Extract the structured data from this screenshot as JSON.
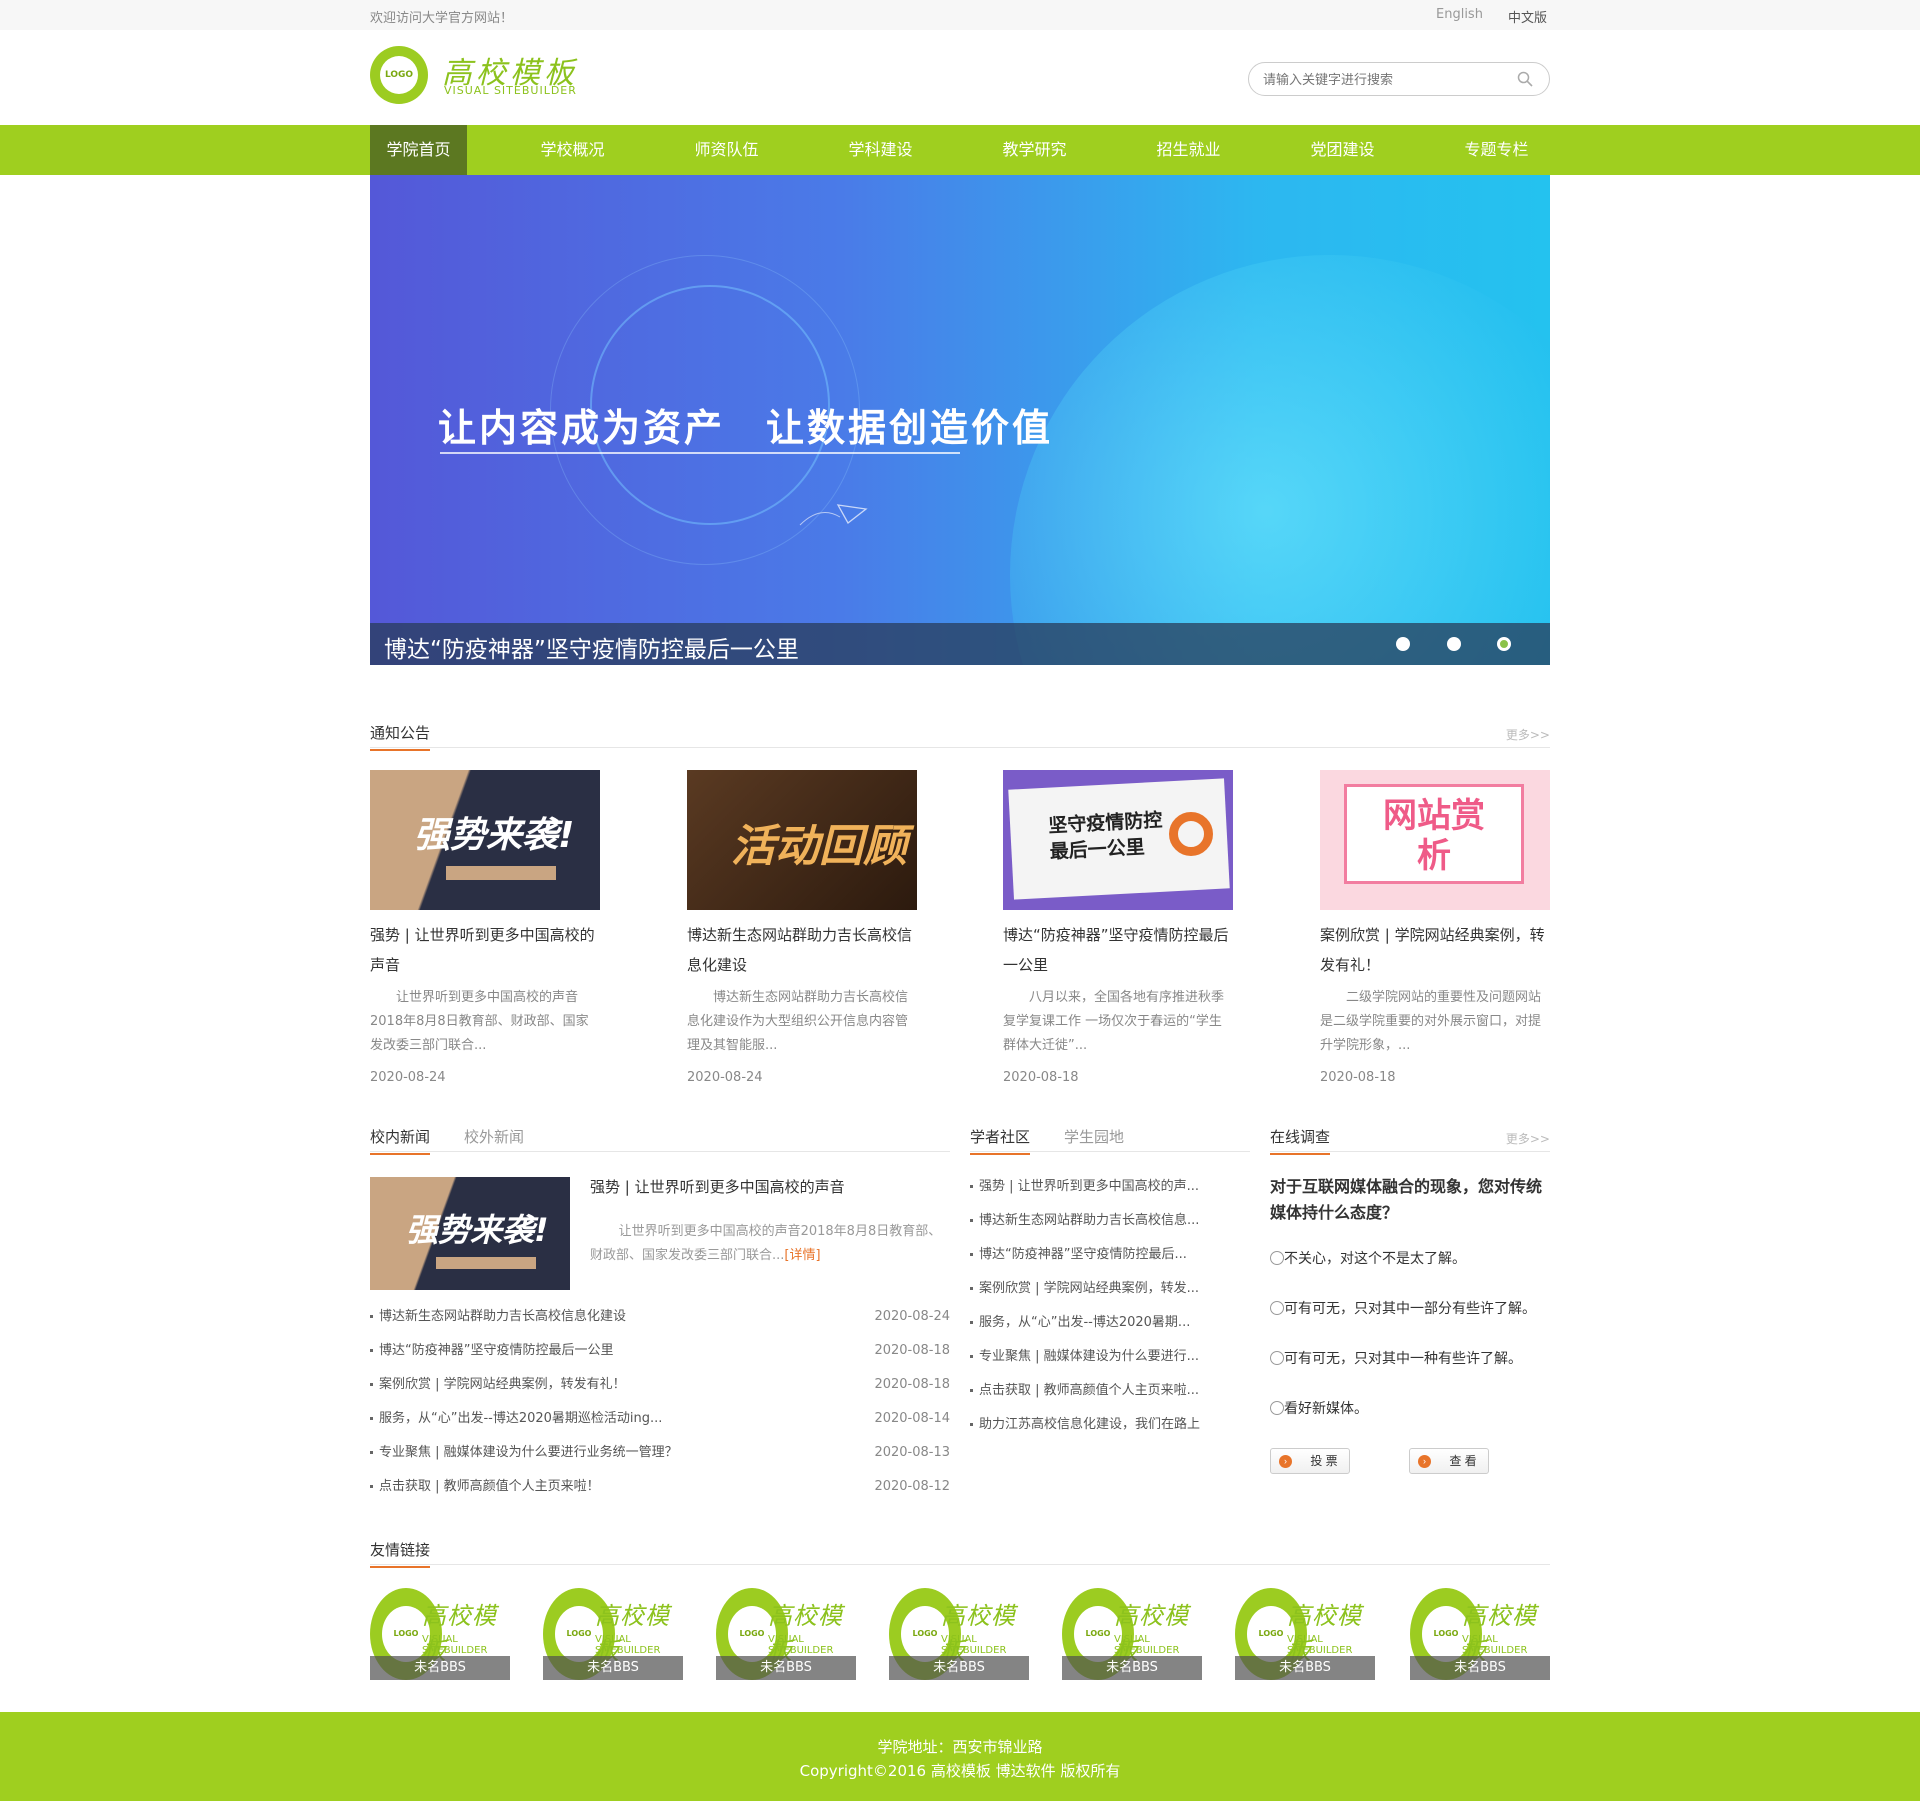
{
  "topbar": {
    "welcome": "欢迎访问大学官方网站！",
    "lang_en": "English",
    "lang_cn": "中文版"
  },
  "header": {
    "logo_badge": "LOGO",
    "logo_title": "高校模板",
    "logo_subtitle": "VISUAL SITEBUILDER",
    "search_placeholder": "请输入关键字进行搜索"
  },
  "nav": {
    "items": [
      {
        "label": "学院首页"
      },
      {
        "label": "学校概况"
      },
      {
        "label": "师资队伍"
      },
      {
        "label": "学科建设"
      },
      {
        "label": "教学研究"
      },
      {
        "label": "招生就业"
      },
      {
        "label": "党团建设"
      },
      {
        "label": "专题专栏"
      }
    ]
  },
  "banner": {
    "slogan": "让内容成为资产　让数据创造价值",
    "caption": "博达“防疫神器”坚守疫情防控最后一公里",
    "active_slide": 3,
    "total_slides": 3
  },
  "notice": {
    "title": "通知公告",
    "more": "更多>>",
    "cards": [
      {
        "thumb_text": "强势来袭!",
        "title": "强势 | 让世界听到更多中国高校的声音",
        "desc": "让世界听到更多中国高校的声音2018年8月8日教育部、财政部、国家发改委三部门联合...",
        "date": "2020-08-24"
      },
      {
        "thumb_text": "活动回顾",
        "title": "博达新生态网站群助力吉长高校信息化建设",
        "desc": "博达新生态网站群助力吉长高校信息化建设作为大型组织公开信息内容管理及其智能服...",
        "date": "2020-08-24"
      },
      {
        "thumb_text": "坚守疫情防控最后一公里",
        "title": "博达“防疫神器”坚守疫情防控最后一公里",
        "desc": "八月以来，全国各地有序推进秋季复学复课工作 一场仅次于春运的“学生群体大迁徙”...",
        "date": "2020-08-18"
      },
      {
        "thumb_text": "网站赏析",
        "title": "案例欣赏 | 学院网站经典案例，转发有礼！",
        "desc": "二级学院网站的重要性及问题网站是二级学院重要的对外展示窗口，对提升学院形象，...",
        "date": "2020-08-18"
      }
    ]
  },
  "news": {
    "tab_active": "校内新闻",
    "tab_other": "校外新闻",
    "feature": {
      "thumb_text": "强势来袭!",
      "title": "强势 | 让世界听到更多中国高校的声音",
      "desc": "让世界听到更多中国高校的声音2018年8月8日教育部、财政部、国家发改委三部门联合...",
      "detail": "[详情]"
    },
    "items": [
      {
        "title": "博达新生态网站群助力吉长高校信息化建设",
        "date": "2020-08-24"
      },
      {
        "title": "博达“防疫神器”坚守疫情防控最后一公里",
        "date": "2020-08-18"
      },
      {
        "title": "案例欣赏 | 学院网站经典案例，转发有礼！",
        "date": "2020-08-18"
      },
      {
        "title": "服务，从“心”出发--博达2020暑期巡检活动ing...",
        "date": "2020-08-14"
      },
      {
        "title": "专业聚焦 | 融媒体建设为什么要进行业务统一管理？",
        "date": "2020-08-13"
      },
      {
        "title": "点击获取 | 教师高颜值个人主页来啦！",
        "date": "2020-08-12"
      }
    ]
  },
  "scholar": {
    "tab_active": "学者社区",
    "tab_other": "学生园地",
    "items": [
      "强势 | 让世界听到更多中国高校的声...",
      "博达新生态网站群助力吉长高校信息...",
      "博达“防疫神器”坚守疫情防控最后...",
      "案例欣赏 | 学院网站经典案例，转发...",
      "服务，从“心”出发--博达2020暑期...",
      "专业聚焦 | 融媒体建设为什么要进行...",
      "点击获取 | 教师高颜值个人主页来啦...",
      "助力江苏高校信息化建设，我们在路上"
    ]
  },
  "survey": {
    "title": "在线调查",
    "more": "更多>>",
    "question": "对于互联网媒体融合的现象，您对传统媒体持什么态度？",
    "options": [
      "不关心，对这个不是太了解。",
      "可有可无，只对其中一部分有些许了解。",
      "可有可无，只对其中一种有些许了解。",
      "看好新媒体。"
    ],
    "vote_label": "投 票",
    "view_label": "查 看"
  },
  "links": {
    "title": "友情链接",
    "items": [
      {
        "label": "未名BBS"
      },
      {
        "label": "未名BBS"
      },
      {
        "label": "未名BBS"
      },
      {
        "label": "未名BBS"
      },
      {
        "label": "未名BBS"
      },
      {
        "label": "未名BBS"
      },
      {
        "label": "未名BBS"
      }
    ]
  },
  "footer": {
    "address": "学院地址：西安市锦业路",
    "copyright": "Copyright©2016 高校模板 博达软件 版权所有"
  },
  "colors": {
    "brand_green": "#9fcf1f",
    "nav_active": "#5c7821",
    "accent_orange": "#e8742a"
  }
}
